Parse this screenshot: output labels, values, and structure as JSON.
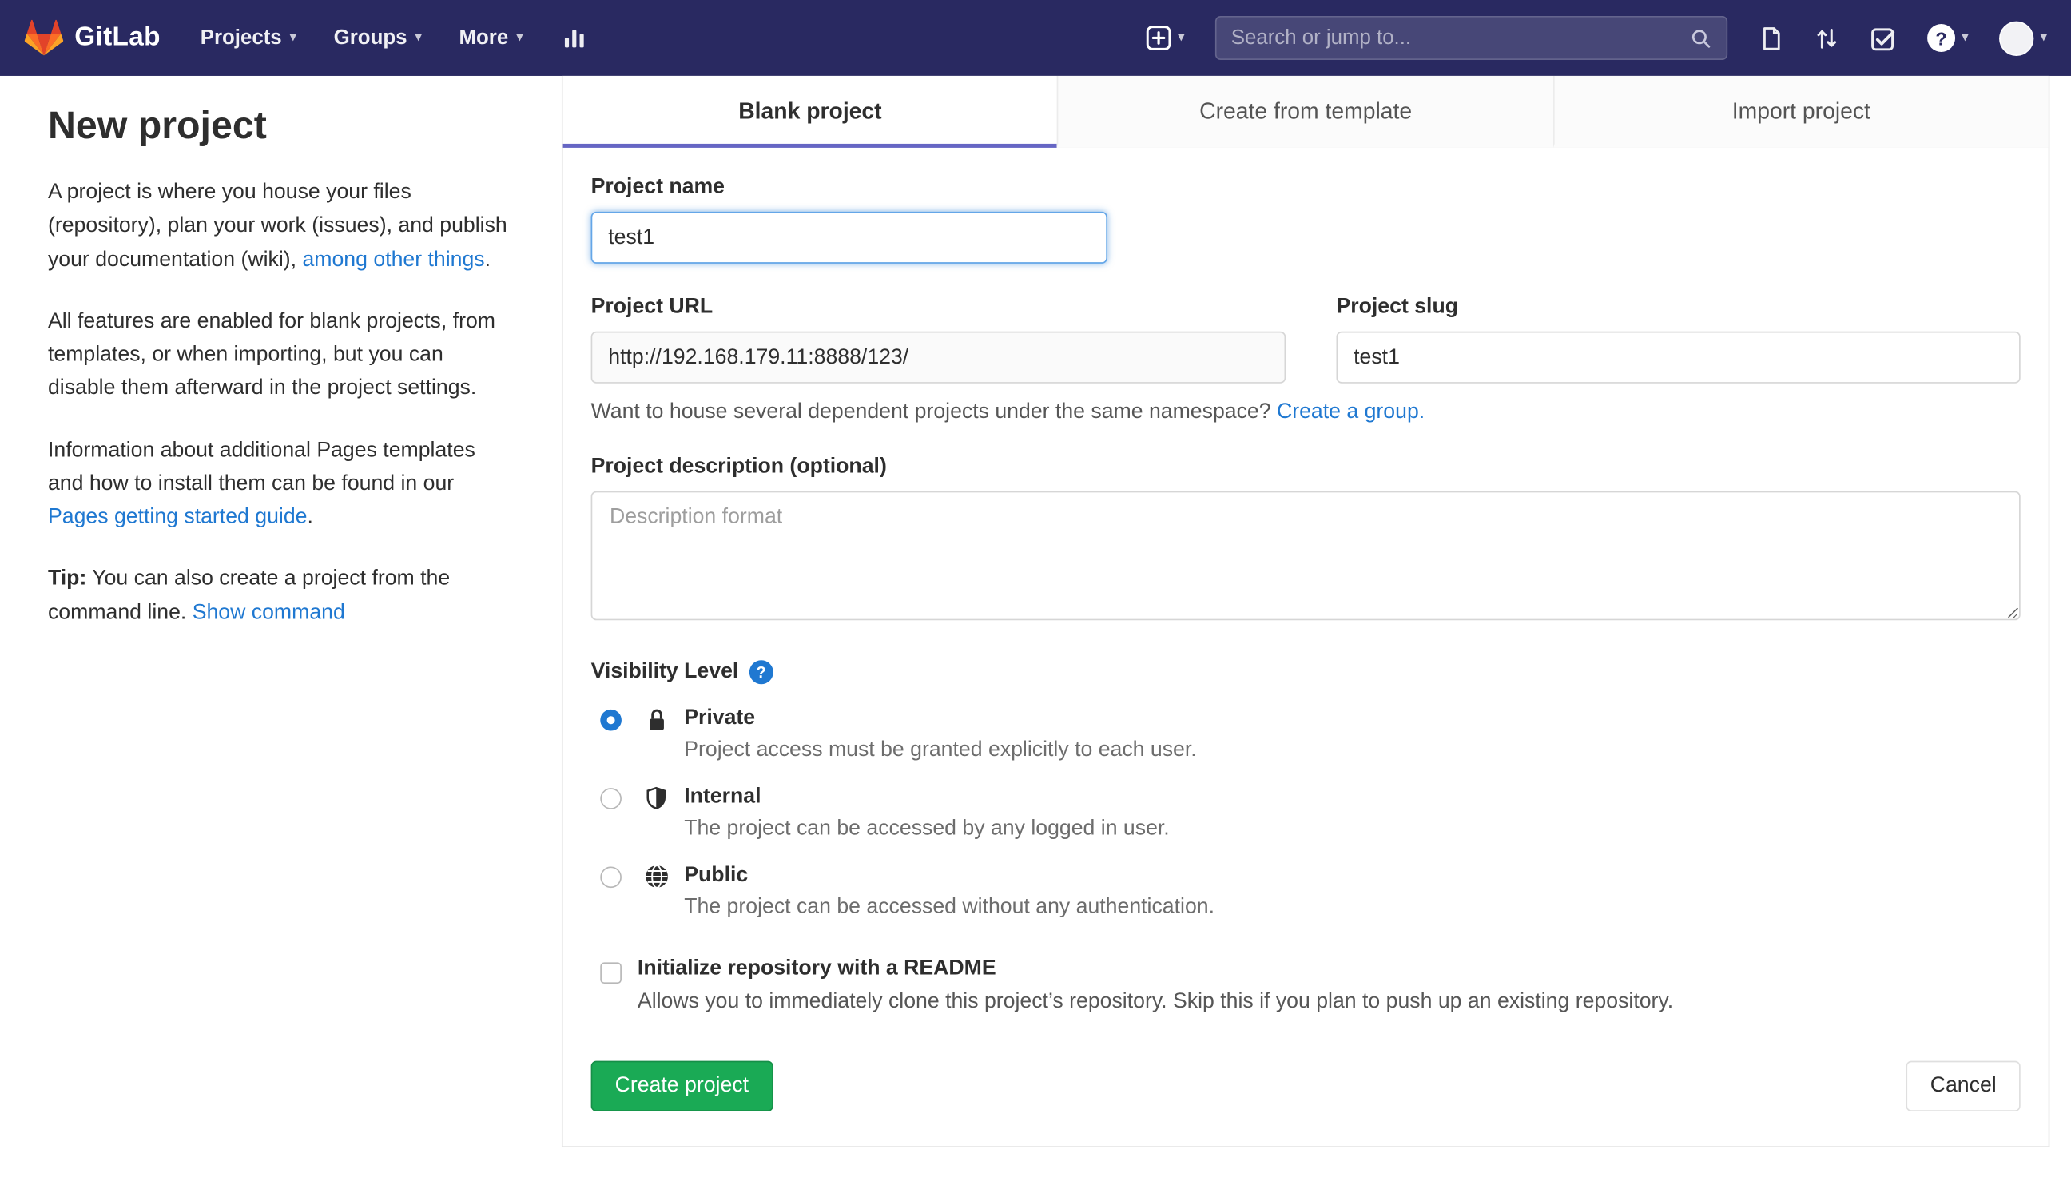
{
  "navbar": {
    "brand": "GitLab",
    "items": [
      {
        "label": "Projects"
      },
      {
        "label": "Groups"
      },
      {
        "label": "More"
      }
    ],
    "search_placeholder": "Search or jump to..."
  },
  "icons": {
    "chevron_down": "▾",
    "help": "?"
  },
  "sidebar": {
    "title": "New project",
    "para1_pre": "A project is where you house your files (repository), plan your work (issues), and publish your documentation (wiki), ",
    "para1_link": "among other things",
    "para1_post": ".",
    "para2": "All features are enabled for blank projects, from templates, or when importing, but you can disable them afterward in the project settings.",
    "para3_pre": "Information about additional Pages templates and how to install them can be found in our ",
    "para3_link": "Pages getting started guide",
    "para3_post": ".",
    "tip_bold": "Tip:",
    "tip_text": " You can also create a project from the command line. ",
    "tip_link": "Show command"
  },
  "tabs": [
    {
      "label": "Blank project",
      "active": true
    },
    {
      "label": "Create from template",
      "active": false
    },
    {
      "label": "Import project",
      "active": false
    }
  ],
  "form": {
    "project_name_label": "Project name",
    "project_name_value": "test1",
    "project_url_label": "Project URL",
    "project_url_value": "http://192.168.179.11:8888/123/",
    "project_slug_label": "Project slug",
    "project_slug_value": "test1",
    "namespace_hint": "Want to house several dependent projects under the same namespace? ",
    "namespace_link": "Create a group.",
    "description_label": "Project description (optional)",
    "description_placeholder": "Description format",
    "visibility_label": "Visibility Level",
    "visibility_options": [
      {
        "name": "Private",
        "desc": "Project access must be granted explicitly to each user.",
        "selected": true
      },
      {
        "name": "Internal",
        "desc": "The project can be accessed by any logged in user.",
        "selected": false
      },
      {
        "name": "Public",
        "desc": "The project can be accessed without any authentication.",
        "selected": false
      }
    ],
    "readme_label": "Initialize repository with a README",
    "readme_desc": "Allows you to immediately clone this project’s repository. Skip this if you plan to push up an existing repository.",
    "create_button": "Create project",
    "cancel_button": "Cancel"
  },
  "colors": {
    "navbar_bg": "#292961",
    "link_blue": "#1f78d1",
    "button_green": "#1aaa55",
    "tab_underline": "#6666c4",
    "logo_red": "#e24329",
    "logo_orange": "#fc6d26",
    "logo_yellow": "#fca326"
  }
}
